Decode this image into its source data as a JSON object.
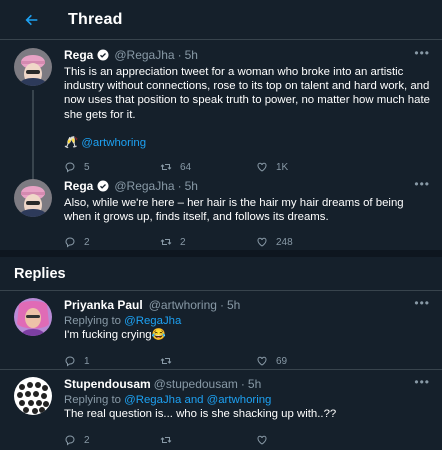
{
  "header": {
    "title": "Thread"
  },
  "thread": [
    {
      "name": "Rega",
      "handle": "@RegaJha",
      "time": "5h",
      "text": "This is an appreciation tweet for a woman who broke into an artistic industry without connections, rose to its top on talent and hard work, and now uses that position to speak truth to power, no matter how much hate she gets for it.",
      "mention_emoji": "🥂",
      "mention": "@artwhoring",
      "replies": "5",
      "retweets": "64",
      "likes": "1K"
    },
    {
      "name": "Rega",
      "handle": "@RegaJha",
      "time": "5h",
      "text": "Also, while we're here – her hair is the hair my hair dreams of being when it grows up, finds itself, and follows its dreams.",
      "replies": "2",
      "retweets": "2",
      "likes": "248"
    }
  ],
  "replies_section": {
    "title": "Replies"
  },
  "replies": [
    {
      "name": "Priyanka Paul",
      "handle": "@artwhoring",
      "time": "5h",
      "replying_prefix": "Replying to ",
      "replying_to": "@RegaJha",
      "text": "I'm fucking crying",
      "emoji": "😂",
      "replies": "1",
      "retweets": "",
      "likes": "69"
    },
    {
      "name": "Stupendousam",
      "handle": "@stupedousam",
      "time": "5h",
      "replying_prefix": "Replying to ",
      "replying_to": "@RegaJha and @artwhoring",
      "text": "The real question is... who is she shacking up with..??",
      "replies": "2",
      "retweets": "",
      "likes": ""
    }
  ],
  "colors": {
    "background": "#15202b",
    "accent": "#1da1f2",
    "muted": "#8899a6",
    "border": "#38444d"
  },
  "icons": {
    "back": "back-arrow-icon",
    "verified": "verified-badge-icon",
    "more": "more-icon",
    "reply": "reply-icon",
    "retweet": "retweet-icon",
    "like": "like-icon"
  }
}
